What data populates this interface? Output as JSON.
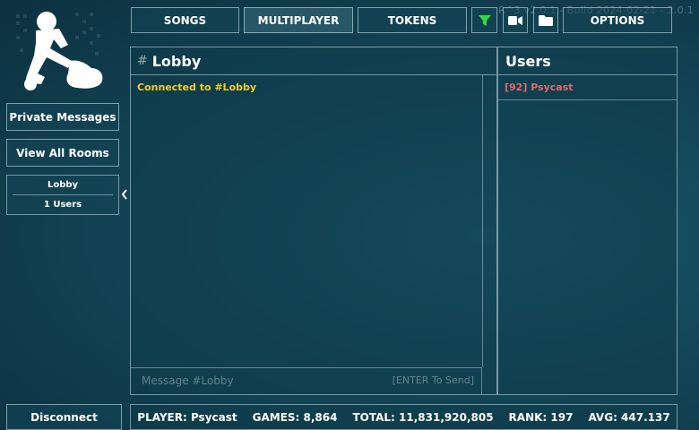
{
  "version": "R^3 v2.0.1 - Build 2024-02-21 - 2.0.1",
  "nav": {
    "songs": "SONGS",
    "multiplayer": "MULTIPLAYER",
    "tokens": "TOKENS",
    "options": "OPTIONS",
    "filter_icon": "filter-icon",
    "video_icon": "video-camera-icon",
    "folder_icon": "folder-icon"
  },
  "sidebar": {
    "private_messages": "Private Messages",
    "view_all_rooms": "View All Rooms",
    "room": {
      "name": "Lobby",
      "users": "1 Users"
    },
    "disconnect": "Disconnect"
  },
  "chat": {
    "hash": "#",
    "title": "Lobby",
    "messages": [
      {
        "text": "Connected to #Lobby",
        "color": "#f2cc2c"
      }
    ],
    "input_placeholder": "Message #Lobby",
    "input_hint": "[ENTER To Send]"
  },
  "users": {
    "title": "Users",
    "list": [
      {
        "label": "[92] Psycast",
        "color": "#e06a6a"
      }
    ]
  },
  "stats": {
    "player": "PLAYER: Psycast",
    "games": "GAMES: 8,864",
    "total": "TOTAL: 11,831,920,805",
    "rank": "RANK: 197",
    "avg": "AVG: 447.137"
  },
  "colors": {
    "accent_filter": "#2fdc3a",
    "message_system": "#f2cc2c",
    "user_name": "#e06a6a"
  }
}
